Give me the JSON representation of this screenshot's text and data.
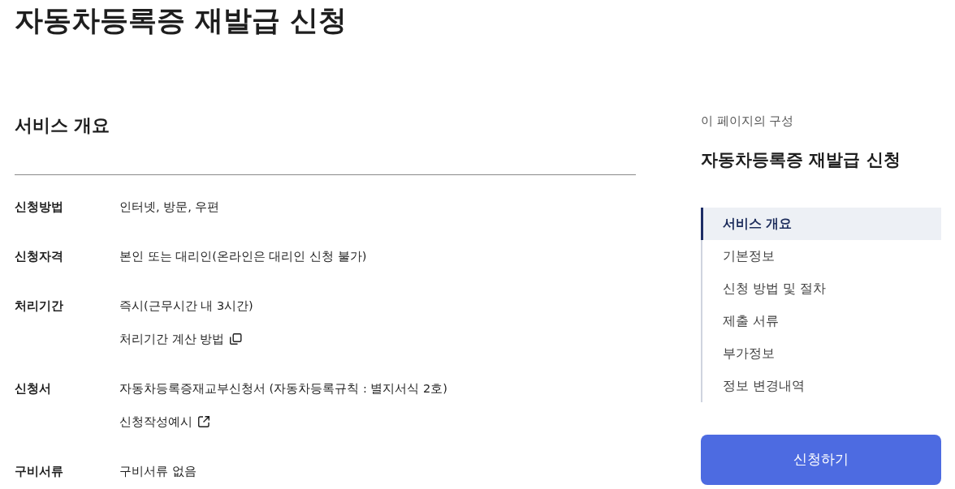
{
  "page_title": "자동차등록증 재발급 신청",
  "overview": {
    "heading": "서비스 개요",
    "rows": [
      {
        "label": "신청방법",
        "values": [
          {
            "kind": "text",
            "text": "인터넷, 방문, 우편"
          }
        ]
      },
      {
        "label": "신청자격",
        "values": [
          {
            "kind": "text",
            "text": "본인 또는 대리인(온라인은 대리인 신청 불가)"
          }
        ]
      },
      {
        "label": "처리기간",
        "values": [
          {
            "kind": "text",
            "text": "즉시(근무시간 내 3시간)"
          },
          {
            "kind": "popup-link",
            "text": "처리기간 계산 방법"
          }
        ]
      },
      {
        "label": "신청서",
        "values": [
          {
            "kind": "text",
            "text": "자동차등록증재교부신청서 (자동차등록규칙 : 별지서식 2호)"
          },
          {
            "kind": "external-link",
            "text": "신청작성예시"
          }
        ]
      },
      {
        "label": "구비서류",
        "values": [
          {
            "kind": "text",
            "text": "구비서류 없음"
          }
        ]
      }
    ]
  },
  "toc": {
    "caption": "이 페이지의 구성",
    "title": "자동차등록증 재발급 신청",
    "items": [
      {
        "label": "서비스 개요",
        "selected": true
      },
      {
        "label": "기본정보",
        "selected": false
      },
      {
        "label": "신청 방법 및 절차",
        "selected": false
      },
      {
        "label": "제출 서류",
        "selected": false
      },
      {
        "label": "부가정보",
        "selected": false
      },
      {
        "label": "정보 변경내역",
        "selected": false
      }
    ]
  },
  "apply_button": "신청하기"
}
